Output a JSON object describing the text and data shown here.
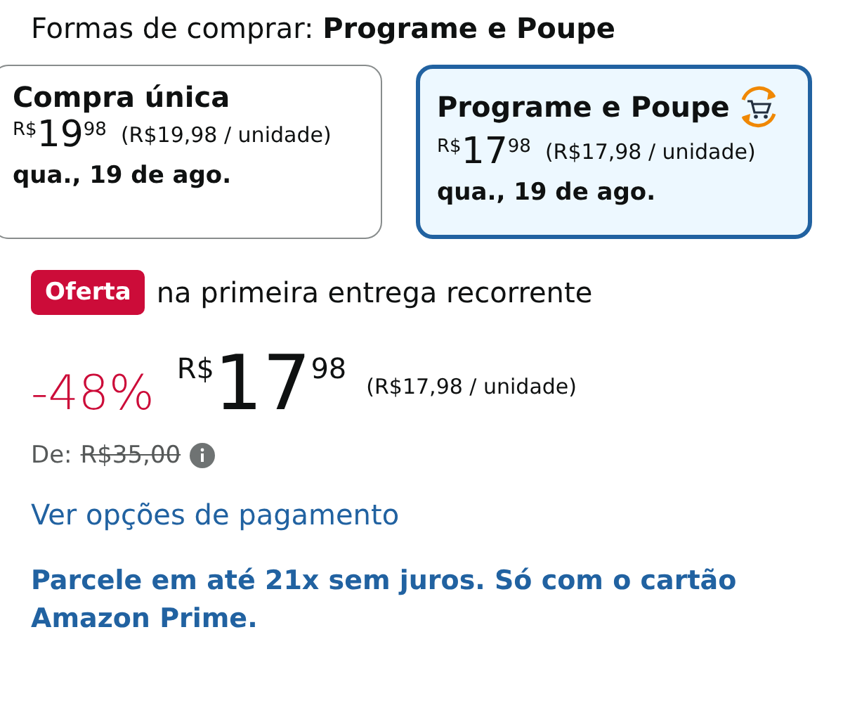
{
  "header": "Formas de comprar: **Programe e Poupe**",
  "options": [
    {
      "title": "Compra única",
      "selected": false,
      "price": {
        "currency": "R$",
        "whole": "19",
        "fraction": "98"
      },
      "unit_price": "(R$19,98 / unidade)",
      "delivery": "qua., 19 de ago."
    },
    {
      "title": "Programe e Poupe",
      "selected": true,
      "price": {
        "currency": "R$",
        "whole": "17",
        "fraction": "98"
      },
      "unit_price": "(R$17,98 / unidade)",
      "delivery": "qua., 19 de ago."
    }
  ],
  "deal": {
    "badge": "Oferta",
    "text": "na primeira entrega recorrente"
  },
  "price": {
    "discount": "-48%",
    "currency": "R$",
    "whole": "17",
    "fraction": "98",
    "unit_price": "(R$17,98 / unidade)"
  },
  "list_price": {
    "label": "De:",
    "value": "R$35,00"
  },
  "payment_link": "Ver opções de pagamento",
  "installments": "Parcele em até 21x sem juros. Só com o cartão Amazon Prime."
}
